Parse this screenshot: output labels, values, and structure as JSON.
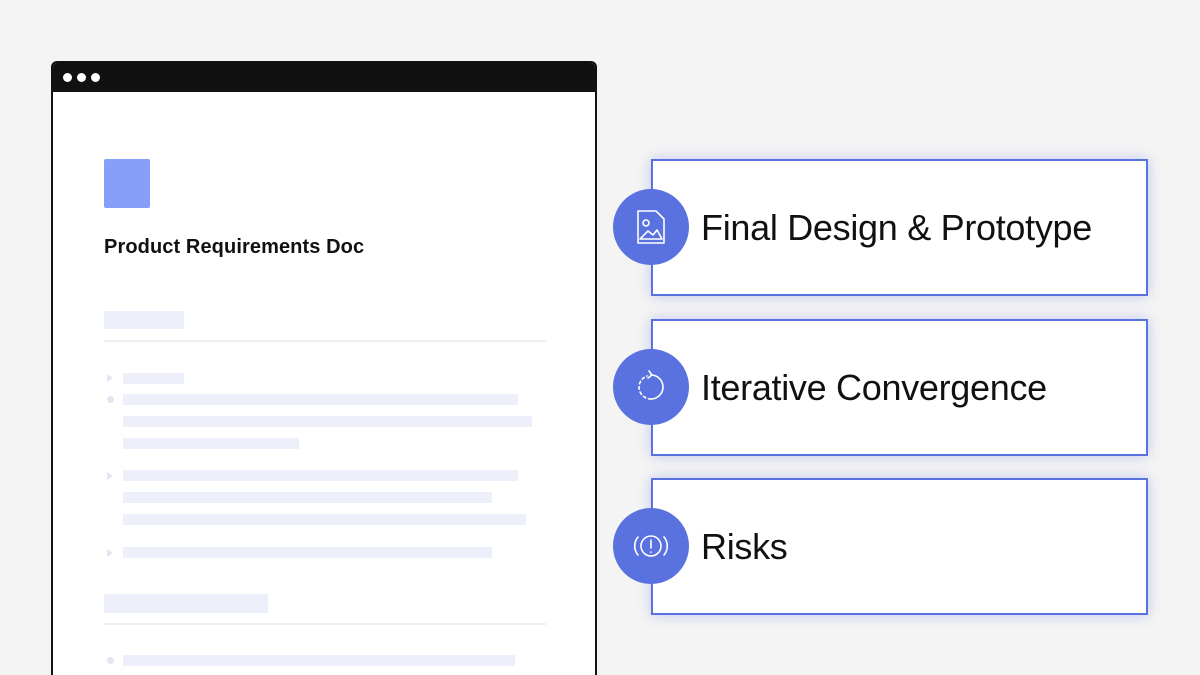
{
  "colors": {
    "accent": "#5a72df",
    "doc_icon": "#879ff9",
    "placeholder": "#edf0fb",
    "window_frame": "#111111"
  },
  "document": {
    "title": "Product Requirements Doc",
    "icon": "document-square-icon"
  },
  "cards": [
    {
      "label": "Final Design & Prototype",
      "icon": "image-file-icon"
    },
    {
      "label": "Iterative Convergence",
      "icon": "refresh-dashed-icon"
    },
    {
      "label": "Risks",
      "icon": "alert-circle-icon"
    }
  ]
}
